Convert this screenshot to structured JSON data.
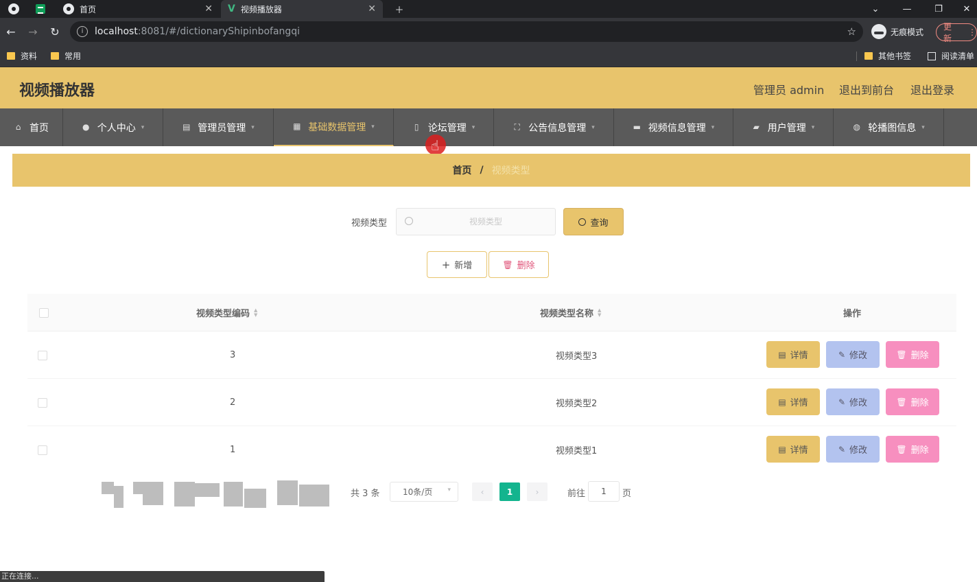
{
  "browser": {
    "tabs": [
      {
        "title": "首页",
        "active": false
      },
      {
        "title": "视频播放器",
        "active": true
      }
    ],
    "url_host": "localhost",
    "url_path": ":8081/#/dictionaryShipinbofangqi",
    "incognito_label": "无痕模式",
    "update_label": "更新",
    "bookmarks": [
      "资料",
      "常用",
      "其他书签",
      "阅读清单"
    ]
  },
  "header": {
    "title": "视频播放器",
    "user_label": "管理员 admin",
    "to_front": "退出到前台",
    "logout": "退出登录"
  },
  "nav": [
    {
      "label": "首页",
      "icon": "home-icon"
    },
    {
      "label": "个人中心",
      "icon": "user-icon"
    },
    {
      "label": "管理员管理",
      "icon": "clipboard-icon"
    },
    {
      "label": "基础数据管理",
      "icon": "grid-icon",
      "active": true
    },
    {
      "label": "论坛管理",
      "icon": "mic-icon"
    },
    {
      "label": "公告信息管理",
      "icon": "fullscreen-icon"
    },
    {
      "label": "视频信息管理",
      "icon": "message-icon"
    },
    {
      "label": "用户管理",
      "icon": "briefcase-icon"
    },
    {
      "label": "轮播图信息",
      "icon": "picture-icon"
    }
  ],
  "breadcrumb": {
    "home": "首页",
    "separator": "/",
    "current": "视频类型"
  },
  "search": {
    "label": "视频类型",
    "placeholder": "视频类型",
    "value": "",
    "query_button": "查询"
  },
  "actions": {
    "add": "新增",
    "delete": "删除"
  },
  "table": {
    "columns": [
      "视频类型编码",
      "视频类型名称",
      "操作"
    ],
    "rows": [
      {
        "code": "3",
        "name": "视频类型3"
      },
      {
        "code": "2",
        "name": "视频类型2"
      },
      {
        "code": "1",
        "name": "视频类型1"
      }
    ],
    "row_actions": {
      "detail": "详情",
      "edit": "修改",
      "remove": "删除"
    }
  },
  "pagination": {
    "total": "共 3 条",
    "page_size": "10条/页",
    "current_page": "1",
    "goto_label": "前往",
    "goto_value": "1",
    "page_suffix": "页"
  },
  "status_text": "正在连接...",
  "colors": {
    "accent": "#e8c46c",
    "nav_bg": "#5a5a5a",
    "page_active": "#13b48e",
    "edit": "#b3c3ef",
    "remove": "#f78fbf"
  }
}
